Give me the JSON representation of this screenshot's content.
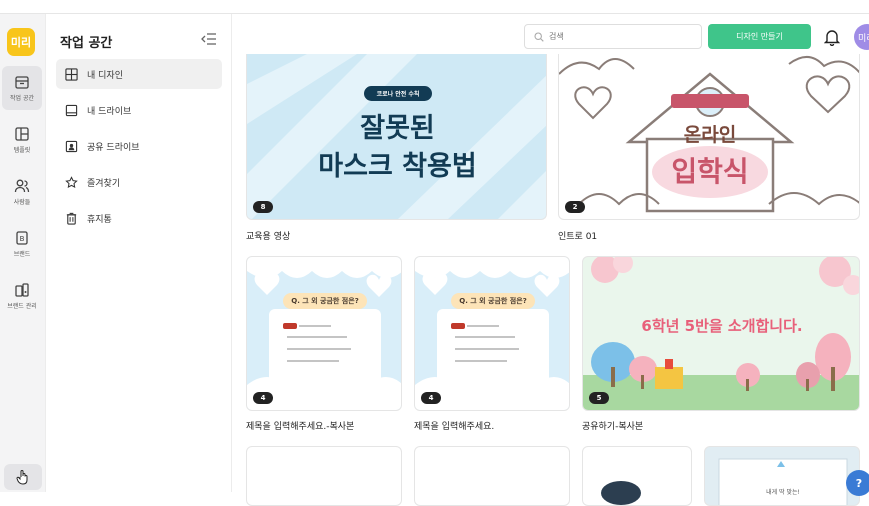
{
  "app": {
    "logo_text": "미리"
  },
  "rail": {
    "items": [
      {
        "label": "작업 공간",
        "icon": "workspace-icon"
      },
      {
        "label": "템플릿",
        "icon": "template-icon"
      },
      {
        "label": "사람들",
        "icon": "people-icon"
      },
      {
        "label": "브랜드",
        "icon": "brand-icon"
      },
      {
        "label": "브랜드 관리",
        "icon": "brand-manage-icon"
      }
    ]
  },
  "sidebar": {
    "title": "작업 공간",
    "items": [
      {
        "label": "내 디자인",
        "icon": "grid-icon"
      },
      {
        "label": "내 드라이브",
        "icon": "drive-icon"
      },
      {
        "label": "공유 드라이브",
        "icon": "shared-drive-icon"
      },
      {
        "label": "즐겨찾기",
        "icon": "star-icon"
      },
      {
        "label": "휴지통",
        "icon": "trash-icon"
      }
    ]
  },
  "header": {
    "search_placeholder": "검색",
    "create_label": "디자인 만들기",
    "avatar_text": "미리"
  },
  "cards": [
    {
      "title": "교육용 영상",
      "count": "8",
      "heading_small": "코로나 안전 수칙",
      "heading_line1": "잘못된",
      "heading_line2": "마스크 착용법"
    },
    {
      "title": "인트로 01",
      "count": "2",
      "banner": "",
      "heading_line1": "온라인",
      "heading_line2": "입학식"
    },
    {
      "title": "제목을 입력해주세요.-복사본",
      "count": "4",
      "question": "Q. 그 외 궁금한 점은?"
    },
    {
      "title": "제목을 입력해주세요.",
      "count": "4",
      "question": "Q. 그 외 궁금한 점은?"
    },
    {
      "title": "공유하기-복사본",
      "count": "5",
      "headline": "6학년 5반을 소개합니다."
    }
  ],
  "bottom_card_text": "내게 딱 맞는!",
  "help_label": "?",
  "colors": {
    "accent": "#3fc58a",
    "logo": "#f8c51b",
    "avatar": "#9f8ce6"
  }
}
